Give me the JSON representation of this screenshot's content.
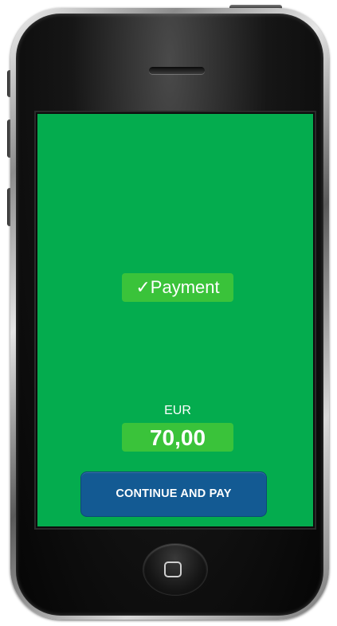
{
  "screen": {
    "background_color": "#04ac4e",
    "status": {
      "check_symbol": "✓",
      "label": "Payment"
    },
    "currency": "EUR",
    "amount": "70,00",
    "continue_button_label": "CONTINUE AND PAY",
    "button_color": "#135a93"
  },
  "device": {
    "home_button_icon": "home-square-icon"
  }
}
